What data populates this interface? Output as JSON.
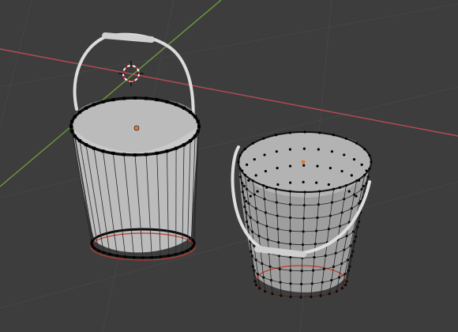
{
  "viewport": {
    "background_color": "#3d3d3d",
    "grid_color": "#444444",
    "x_axis_color": "#b84b55",
    "y_axis_color": "#6f9a3c"
  },
  "scene": {
    "objects": [
      {
        "name": "bucket",
        "state": "selected-object",
        "mesh_color": "#bdbdbd",
        "wire_color": "#111111"
      },
      {
        "name": "bucket-mesh",
        "state": "edit-mode-vertices",
        "mesh_color": "#a8a8a8",
        "wire_color": "#111111"
      }
    ],
    "origin_marker_color": "#e07b35",
    "vertex_color": "#000000",
    "cursor_3d": {
      "outer_color": "#ffffff",
      "inner_color": "#d23030",
      "icon": "3d-cursor-icon"
    }
  }
}
